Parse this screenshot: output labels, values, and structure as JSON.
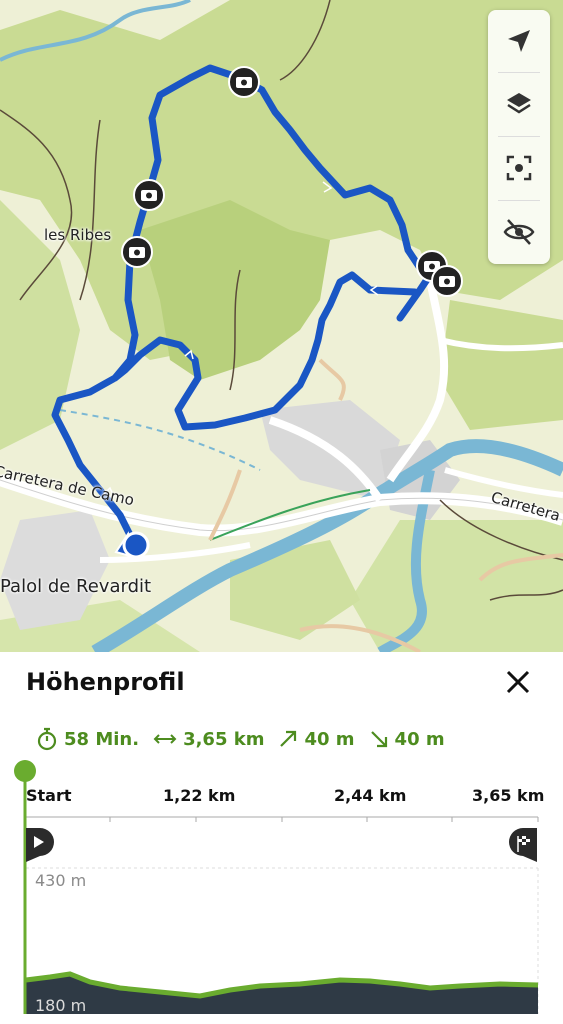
{
  "map": {
    "place_labels": {
      "les_ribes": "les Ribes",
      "palol_de_revardit": "Palol de Revardit",
      "carretera_de_camos": "Carretera de Camo",
      "carretera_east": "Carretera"
    },
    "toolbar": [
      {
        "icon": "navigate-arrow-icon"
      },
      {
        "icon": "layers-icon"
      },
      {
        "icon": "focus-frame-icon"
      },
      {
        "icon": "eye-off-icon"
      }
    ],
    "colors": {
      "route": "#1a56c4",
      "forest": "#c6d98f",
      "river": "#79b8d6"
    }
  },
  "panel": {
    "title": "Höhenprofil",
    "stats": {
      "duration": "58 Min.",
      "distance": "3,65 km",
      "ascent": "40 m",
      "descent": "40 m"
    },
    "axis": {
      "start": "Start",
      "mark1": "1,22 km",
      "mark2": "2,44 km",
      "end": "3,65 km"
    },
    "elevation": {
      "max_label": "430 m",
      "min_label": "180 m"
    },
    "accent_color": "#4d8c1f"
  }
}
